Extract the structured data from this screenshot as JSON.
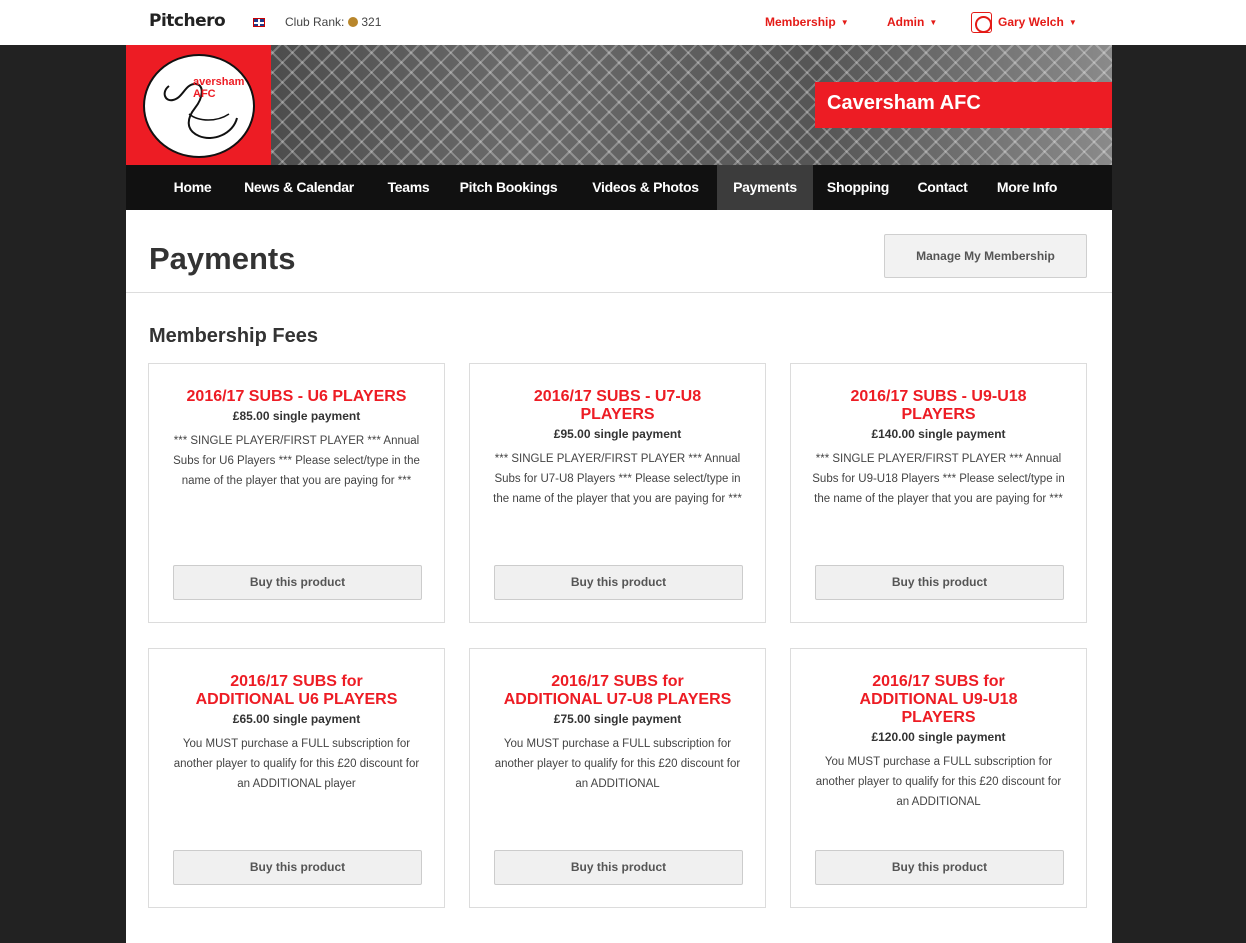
{
  "topbar": {
    "brand": "Pitchero",
    "club_rank_label": "Club Rank:",
    "club_rank_value": "321",
    "membership": "Membership",
    "admin": "Admin",
    "user": "Gary Welch"
  },
  "banner": {
    "logo_text": "aversham AFC",
    "club_name": "Caversham AFC"
  },
  "nav": [
    "Home",
    "News & Calendar",
    "Teams",
    "Pitch Bookings",
    "Videos & Photos",
    "Payments",
    "Shopping",
    "Contact",
    "More Info"
  ],
  "page": {
    "title": "Payments",
    "manage_button": "Manage My Membership",
    "section_title": "Membership Fees"
  },
  "products": [
    {
      "title": "2016/17 SUBS - U6 PLAYERS",
      "price": "£85.00 single payment",
      "description": "*** SINGLE PLAYER/FIRST PLAYER *** Annual Subs for U6 Players *** Please select/type in the name of the player that you are paying for ***",
      "button": "Buy this product"
    },
    {
      "title": "2016/17 SUBS - U7-U8 PLAYERS",
      "price": "£95.00 single payment",
      "description": "*** SINGLE PLAYER/FIRST PLAYER *** Annual Subs for U7-U8 Players *** Please select/type in the name of the player that you are paying for ***",
      "button": "Buy this product"
    },
    {
      "title": "2016/17 SUBS - U9-U18 PLAYERS",
      "price": "£140.00 single payment",
      "description": "*** SINGLE PLAYER/FIRST PLAYER *** Annual Subs for U9-U18 Players *** Please select/type in the name of the player that you are paying for ***",
      "button": "Buy this product"
    },
    {
      "title": "2016/17 SUBS for ADDITIONAL U6 PLAYERS",
      "price": "£65.00 single payment",
      "description": "You MUST purchase a FULL subscription for another player to qualify for this £20 discount for an ADDITIONAL player",
      "button": "Buy this product"
    },
    {
      "title": "2016/17 SUBS for ADDITIONAL U7-U8 PLAYERS",
      "price": "£75.00 single payment",
      "description": "You MUST purchase a FULL subscription for another player to qualify for this £20 discount for an ADDITIONAL",
      "button": "Buy this product"
    },
    {
      "title": "2016/17 SUBS for ADDITIONAL U9-U18 PLAYERS",
      "price": "£120.00 single payment",
      "description": "You MUST purchase a FULL subscription for another player to qualify for this £20 discount for an ADDITIONAL",
      "button": "Buy this product"
    }
  ],
  "colors": {
    "accent": "#ed1c24",
    "nav_bg": "#111111",
    "page_bg": "#222222"
  },
  "icons": {
    "flag": "uk-flag-icon",
    "medal": "medal-icon",
    "avatar": "user-avatar-icon",
    "dropdown": "caret-down-icon"
  }
}
